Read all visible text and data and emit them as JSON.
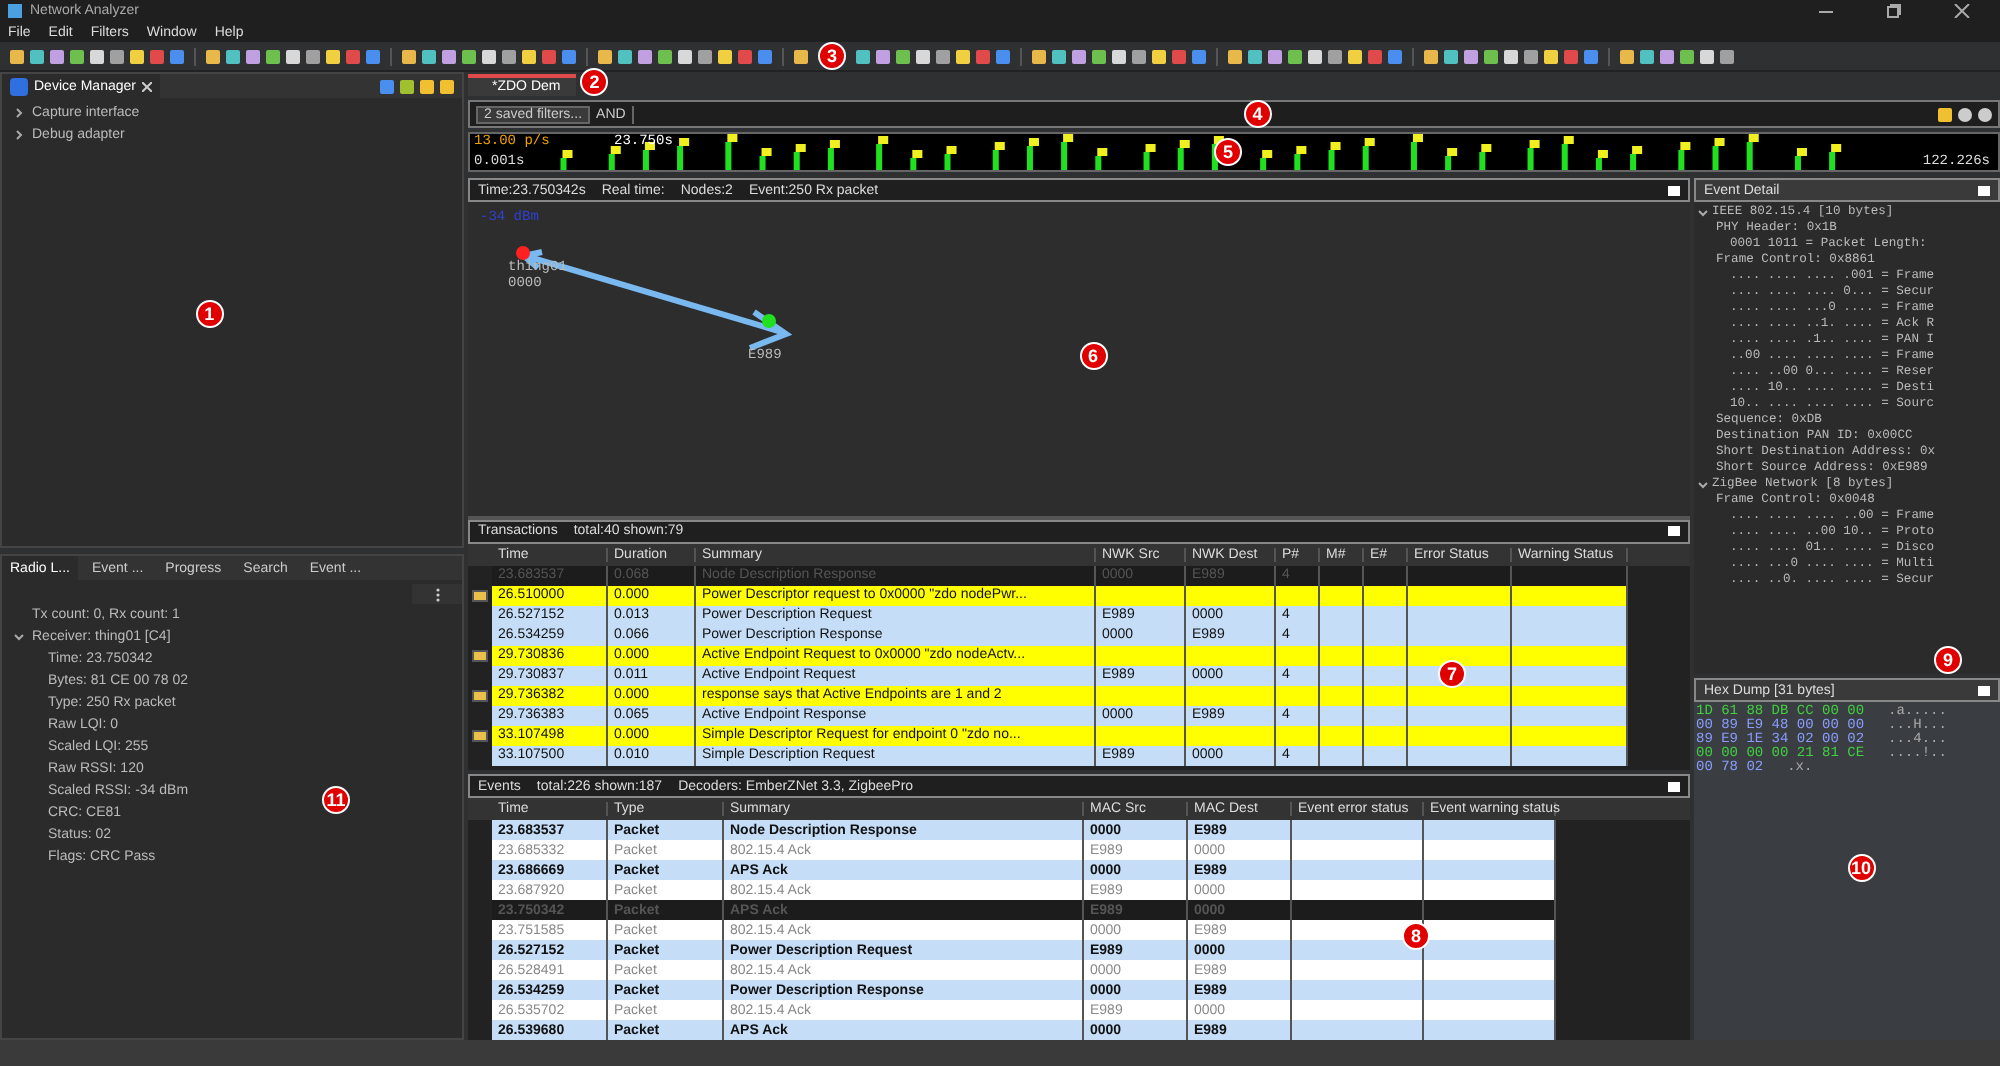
{
  "window": {
    "title": "Network Analyzer"
  },
  "menu": [
    "File",
    "Edit",
    "Filters",
    "Window",
    "Help"
  ],
  "toolbar": {
    "callout": "3"
  },
  "device_manager": {
    "tab": "Device Manager",
    "callout": "1",
    "items": [
      {
        "label": "Capture interface",
        "expanded": false
      },
      {
        "label": "Debug adapter",
        "expanded": false
      }
    ]
  },
  "bottom_left": {
    "callout": "11",
    "tabs": [
      {
        "label": "Radio L...",
        "selected": true
      },
      {
        "label": "Event ...",
        "selected": false
      },
      {
        "label": "Progress",
        "selected": false
      },
      {
        "label": "Search",
        "selected": false
      },
      {
        "label": "Event ...",
        "selected": false
      }
    ],
    "tree": [
      {
        "label": "Tx count: 0, Rx count: 1"
      },
      {
        "label": "Receiver: thing01 [C4]",
        "expanded": true,
        "children": [
          {
            "label": "Time: 23.750342"
          },
          {
            "label": "Bytes: 81 CE 00 78 02"
          },
          {
            "label": "Type: 250 Rx packet"
          },
          {
            "label": "Raw LQI: 0"
          },
          {
            "label": "Scaled LQI: 255"
          },
          {
            "label": "Raw RSSI: 120"
          },
          {
            "label": "Scaled RSSI: -34 dBm"
          },
          {
            "label": "CRC: CE81"
          },
          {
            "label": "Status: 02"
          },
          {
            "label": "Flags: CRC Pass"
          }
        ]
      }
    ]
  },
  "editor": {
    "tab": "*ZDO Dem",
    "callout": "2"
  },
  "filter": {
    "saved": "2 saved filters...",
    "operator": "AND",
    "callout": "4"
  },
  "timeline": {
    "rate": "13.00 p/s",
    "cursor": "23.750s",
    "start": "0.001s",
    "end": "122.226s",
    "callout": "5"
  },
  "map": {
    "callout": "6",
    "info": [
      "Time:23.750342s",
      "Real time:",
      "Nodes:2",
      "Event:250 Rx packet"
    ],
    "signal": "-34 dBm",
    "nodes": [
      {
        "name": "thing01",
        "address": "0000",
        "color": "#ff2020"
      },
      {
        "name": "E989",
        "color": "#20e020"
      }
    ]
  },
  "transactions": {
    "title": "Transactions",
    "counts": "total:40 shown:79",
    "callout": "7",
    "columns": [
      "Time",
      "Duration",
      "Summary",
      "NWK Src",
      "NWK Dest",
      "P#",
      "M#",
      "E#",
      "Error Status",
      "Warning Status"
    ],
    "rows": [
      {
        "kind": "packet",
        "selected": true,
        "cells": [
          "23.683537",
          "0.068",
          "Node Description Response",
          "0000",
          "E989",
          "4"
        ]
      },
      {
        "kind": "note",
        "selected": false,
        "cells": [
          "26.510000",
          "0.000",
          "Power Descriptor request to 0x0000 \"zdo nodePwr...",
          "",
          "",
          ""
        ]
      },
      {
        "kind": "packet",
        "selected": false,
        "cells": [
          "26.527152",
          "0.013",
          "Power Description Request",
          "E989",
          "0000",
          "4"
        ]
      },
      {
        "kind": "packet",
        "selected": false,
        "cells": [
          "26.534259",
          "0.066",
          "Power Description Response",
          "0000",
          "E989",
          "4"
        ]
      },
      {
        "kind": "note",
        "selected": false,
        "cells": [
          "29.730836",
          "0.000",
          "Active Endpoint Request to 0x0000 \"zdo nodeActv...",
          "",
          "",
          ""
        ]
      },
      {
        "kind": "packet",
        "selected": false,
        "cells": [
          "29.730837",
          "0.011",
          "Active Endpoint Request",
          "E989",
          "0000",
          "4"
        ]
      },
      {
        "kind": "note",
        "selected": false,
        "cells": [
          "29.736382",
          "0.000",
          "response says that Active Endpoints are 1 and 2",
          "",
          "",
          ""
        ]
      },
      {
        "kind": "packet",
        "selected": false,
        "cells": [
          "29.736383",
          "0.065",
          "Active Endpoint Response",
          "0000",
          "E989",
          "4"
        ]
      },
      {
        "kind": "note",
        "selected": false,
        "cells": [
          "33.107498",
          "0.000",
          "Simple Descriptor Request for endpoint 0 \"zdo no...",
          "",
          "",
          ""
        ]
      },
      {
        "kind": "packet",
        "selected": false,
        "cells": [
          "33.107500",
          "0.010",
          "Simple Description Request",
          "E989",
          "0000",
          "4"
        ]
      }
    ]
  },
  "events": {
    "title": "Events",
    "counts": "total:226 shown:187",
    "decoders": "Decoders: EmberZNet 3.3, ZigbeePro",
    "callout": "8",
    "columns": [
      "Time",
      "Type",
      "Summary",
      "MAC Src",
      "MAC Dest",
      "Event error status",
      "Event warning status"
    ],
    "rows": [
      {
        "kind": "packet",
        "selected": false,
        "cells": [
          "23.683537",
          "Packet",
          "Node Description Response",
          "0000",
          "E989"
        ]
      },
      {
        "kind": "ack",
        "selected": false,
        "cells": [
          "23.685332",
          "Packet",
          "802.15.4 Ack",
          "E989",
          "0000"
        ]
      },
      {
        "kind": "packet",
        "selected": false,
        "cells": [
          "23.686669",
          "Packet",
          "APS Ack",
          "0000",
          "E989"
        ]
      },
      {
        "kind": "ack",
        "selected": false,
        "cells": [
          "23.687920",
          "Packet",
          "802.15.4 Ack",
          "E989",
          "0000"
        ]
      },
      {
        "kind": "packet",
        "selected": true,
        "cells": [
          "23.750342",
          "Packet",
          "APS Ack",
          "E989",
          "0000"
        ]
      },
      {
        "kind": "ack",
        "selected": false,
        "cells": [
          "23.751585",
          "Packet",
          "802.15.4 Ack",
          "0000",
          "E989"
        ]
      },
      {
        "kind": "packet",
        "selected": false,
        "cells": [
          "26.527152",
          "Packet",
          "Power Description Request",
          "E989",
          "0000"
        ]
      },
      {
        "kind": "ack",
        "selected": false,
        "cells": [
          "26.528491",
          "Packet",
          "802.15.4 Ack",
          "0000",
          "E989"
        ]
      },
      {
        "kind": "packet",
        "selected": false,
        "cells": [
          "26.534259",
          "Packet",
          "Power Description Response",
          "0000",
          "E989"
        ]
      },
      {
        "kind": "ack",
        "selected": false,
        "cells": [
          "26.535702",
          "Packet",
          "802.15.4 Ack",
          "E989",
          "0000"
        ]
      },
      {
        "kind": "packet",
        "selected": false,
        "cells": [
          "26.539680",
          "Packet",
          "APS Ack",
          "0000",
          "E989"
        ]
      }
    ]
  },
  "event_detail": {
    "title": "Event Detail",
    "callout": "9",
    "tree": [
      {
        "label": "IEEE 802.15.4 [10 bytes]",
        "expanded": true,
        "children": [
          {
            "label": "PHY Header: 0x1B",
            "children": [
              {
                "label": "0001 1011 = Packet Length:"
              }
            ]
          },
          {
            "label": "Frame Control: 0x8861",
            "children": [
              {
                "label": ".... .... .... .001 = Frame"
              },
              {
                "label": ".... .... .... 0... = Secur"
              },
              {
                "label": ".... .... ...0 .... = Frame"
              },
              {
                "label": ".... .... ..1. .... = Ack R"
              },
              {
                "label": ".... .... .1.. .... = PAN I"
              },
              {
                "label": "..00 .... .... .... = Frame"
              },
              {
                "label": ".... ..00 0... .... = Reser"
              },
              {
                "label": ".... 10.. .... .... = Desti"
              },
              {
                "label": "10.. .... .... .... = Sourc"
              }
            ]
          },
          {
            "label": "Sequence: 0xDB"
          },
          {
            "label": "Destination PAN ID: 0x00CC"
          },
          {
            "label": "Short Destination Address: 0x"
          },
          {
            "label": "Short Source Address: 0xE989"
          }
        ]
      },
      {
        "label": "ZigBee Network [8 bytes]",
        "expanded": true,
        "children": [
          {
            "label": "Frame Control: 0x0048",
            "children": [
              {
                "label": ".... .... .... ..00 = Frame"
              },
              {
                "label": ".... .... ..00 10.. = Proto"
              },
              {
                "label": ".... .... 01.. .... = Disco"
              },
              {
                "label": ".... ...0 .... .... = Multi"
              },
              {
                "label": ".... ..0. .... .... = Secur"
              }
            ]
          }
        ]
      }
    ]
  },
  "hex_dump": {
    "title": "Hex Dump [31 bytes]",
    "callout": "10",
    "lines": [
      {
        "bytes": "1D 61 88 DB CC 00 00",
        "ascii": ".a....."
      },
      {
        "bytes": "00 89 E9 48 00 00 00",
        "ascii": "...H..."
      },
      {
        "bytes": "89 E9 1E 34 02 00 02",
        "ascii": "...4..."
      },
      {
        "bytes": "00 00 00 00 21 81 CE",
        "ascii": "....!.."
      },
      {
        "bytes": "00 78 02",
        "ascii": ".x."
      }
    ]
  }
}
